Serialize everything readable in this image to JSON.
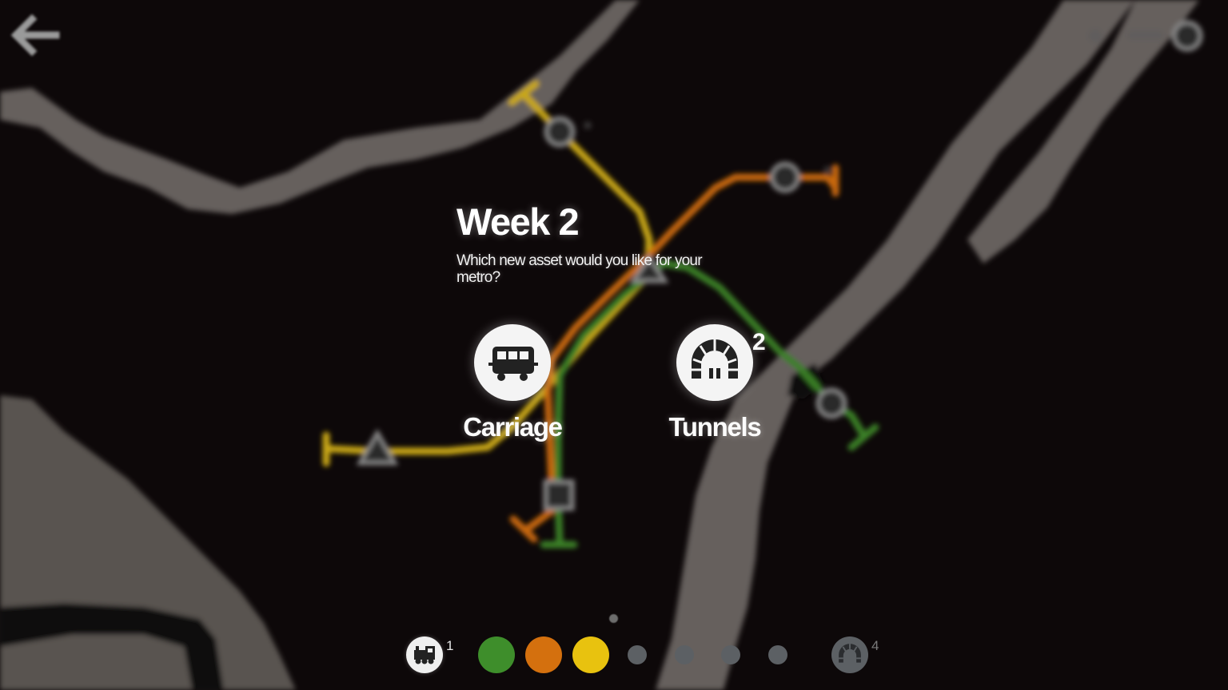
{
  "dialog": {
    "title": "Week 2",
    "subtitle": "Which new asset would you like for your metro?",
    "choices": [
      {
        "label": "Carriage",
        "icon": "carriage-icon"
      },
      {
        "label": "Tunnels",
        "icon": "tunnel-icon",
        "count": "2"
      }
    ]
  },
  "hud": {
    "page_indicator": "1 of 1",
    "locomotives": {
      "icon": "locomotive-icon",
      "count": "1"
    },
    "lines": [
      {
        "name": "green",
        "color": "#3e8e2b",
        "available": true
      },
      {
        "name": "orange",
        "color": "#d4700e",
        "available": true
      },
      {
        "name": "yellow",
        "color": "#e8c20f",
        "available": true
      },
      {
        "name": "locked-1",
        "color": "#5c6064",
        "available": false
      },
      {
        "name": "locked-2",
        "color": "#5c6064",
        "available": false
      },
      {
        "name": "locked-3",
        "color": "#5c6064",
        "available": false
      },
      {
        "name": "locked-4",
        "color": "#5c6064",
        "available": false
      }
    ],
    "tunnels": {
      "icon": "tunnel-icon",
      "count": "4"
    }
  },
  "colors": {
    "background": "#0d0809",
    "water": "#6e6864",
    "line_green": "#3e8e2b",
    "line_orange": "#d4700e",
    "line_yellow": "#e8c20f",
    "station": "#5a5a5a"
  }
}
